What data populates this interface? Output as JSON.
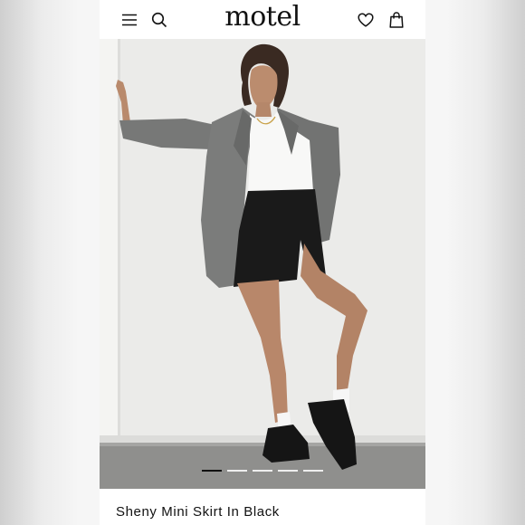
{
  "header": {
    "logo_text": "motel",
    "icons": [
      "menu-icon",
      "search-icon",
      "heart-icon",
      "bag-icon"
    ]
  },
  "gallery": {
    "image_count": 5,
    "active_index": 0
  },
  "product": {
    "name": "Sheny Mini Skirt In Black"
  },
  "colors": {
    "text": "#111111",
    "background": "#ffffff",
    "indicator_active": "#111111",
    "indicator_inactive": "#ffffff"
  }
}
